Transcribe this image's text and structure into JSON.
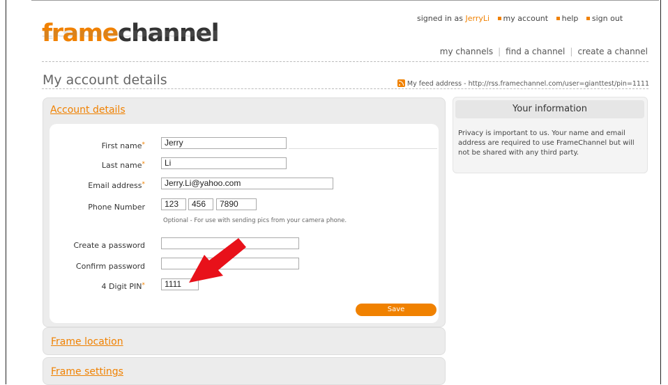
{
  "brand": {
    "part1": "frame",
    "part2": "channel"
  },
  "topbar": {
    "signed_in_prefix": "signed in as ",
    "username": "JerryLi",
    "links": [
      "my account",
      "help",
      "sign out"
    ]
  },
  "nav": {
    "items": [
      "my channels",
      "find a channel",
      "create a channel"
    ]
  },
  "page": {
    "title": "My account details",
    "feed_text": "My feed address - http://rss.framechannel.com/user=gianttest/pin=1111"
  },
  "account": {
    "section_title": "Account details",
    "labels": {
      "first_name": "First name",
      "last_name": "Last name",
      "email": "Email address",
      "phone": "Phone Number",
      "create_password": "Create a password",
      "confirm_password": "Confirm password",
      "pin": "4 Digit PIN"
    },
    "required_mark": "*",
    "values": {
      "first_name": "Jerry",
      "last_name": "Li",
      "email": "Jerry.Li@yahoo.com",
      "phone_area": "123",
      "phone_prefix": "456",
      "phone_line": "7890",
      "create_password": "",
      "confirm_password": "",
      "pin": "1111"
    },
    "phone_hint": "Optional - For use with sending pics from your camera phone.",
    "save_label": "Save"
  },
  "sections": {
    "frame_location": "Frame location",
    "frame_settings": "Frame settings"
  },
  "sidebar": {
    "title": "Your information",
    "text": "Privacy is important to us. Your name and email address are required to use FrameChannel but will not be shared with any third party."
  },
  "colors": {
    "accent": "#f08100",
    "annotation_arrow": "#e8111a"
  },
  "icons": {
    "feed": "rss-icon",
    "annotation": "red-arrow-annotation"
  }
}
